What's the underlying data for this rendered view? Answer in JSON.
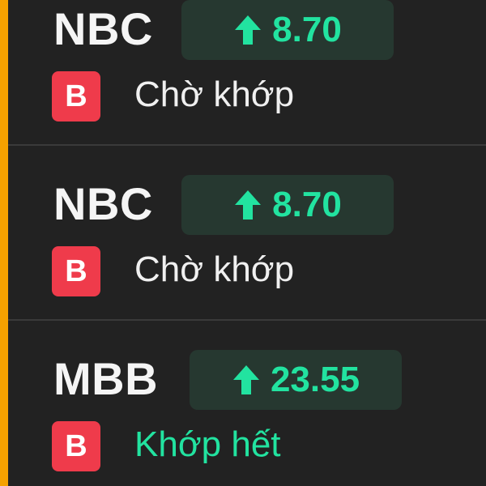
{
  "colors": {
    "background": "#222222",
    "left_accent": "#f5a100",
    "up": "#22e3a0",
    "price_badge_bg": "#263830",
    "buy_badge_bg": "#ef3b4b",
    "divider": "#3a3a3a"
  },
  "orders": [
    {
      "symbol": "NBC",
      "trend_icon": "arrow-up-icon",
      "price": "8.70",
      "side": "B",
      "status": "Chờ khớp"
    },
    {
      "symbol": "NBC",
      "trend_icon": "arrow-up-icon",
      "price": "8.70",
      "side": "B",
      "status": "Chờ khớp"
    },
    {
      "symbol": "MBB",
      "trend_icon": "arrow-up-icon",
      "price": "23.55",
      "side": "B",
      "status": "Khớp hết"
    }
  ]
}
